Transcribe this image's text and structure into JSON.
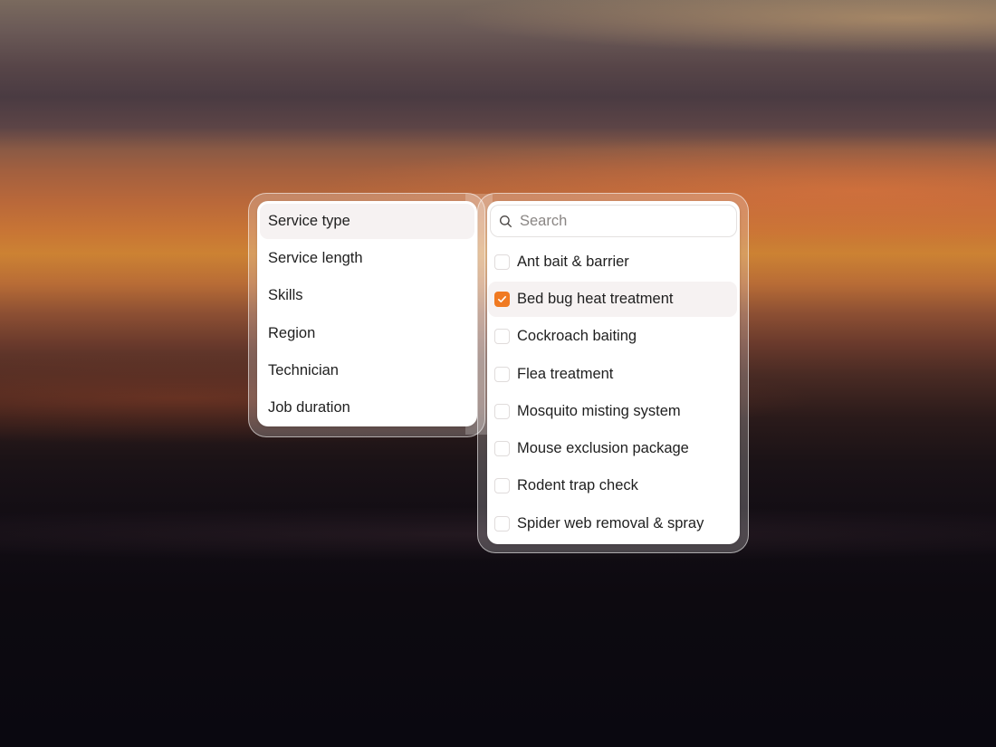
{
  "theme": {
    "accent": "#f07a22"
  },
  "categories": [
    {
      "label": "Service type",
      "active": true
    },
    {
      "label": "Service length",
      "active": false
    },
    {
      "label": "Skills",
      "active": false
    },
    {
      "label": "Region",
      "active": false
    },
    {
      "label": "Technician",
      "active": false
    },
    {
      "label": "Job duration",
      "active": false
    }
  ],
  "search": {
    "placeholder": "Search",
    "value": "",
    "icon": "search-icon"
  },
  "options": [
    {
      "label": "Ant bait & barrier",
      "checked": false
    },
    {
      "label": "Bed bug heat treatment",
      "checked": true
    },
    {
      "label": "Cockroach baiting",
      "checked": false
    },
    {
      "label": "Flea treatment",
      "checked": false
    },
    {
      "label": "Mosquito misting system",
      "checked": false
    },
    {
      "label": "Mouse exclusion package",
      "checked": false
    },
    {
      "label": "Rodent trap check",
      "checked": false
    },
    {
      "label": "Spider web removal & spray",
      "checked": false
    }
  ]
}
